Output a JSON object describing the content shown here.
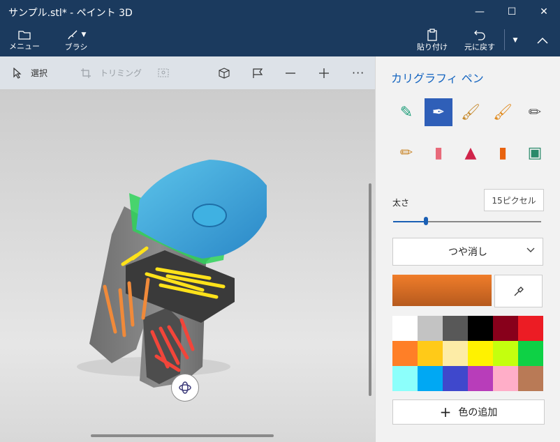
{
  "window": {
    "title": "サンプル.stl* - ペイント 3D",
    "minimize_glyph": "—",
    "maximize_glyph": "☐",
    "close_glyph": "✕"
  },
  "ribbon": {
    "menu_label": "メニュー",
    "brush_label": "ブラシ",
    "paste_label": "貼り付け",
    "undo_label": "元に戻す"
  },
  "toolbar": {
    "select_label": "選択",
    "trim_label": "トリミング"
  },
  "panel": {
    "title": "カリグラフィ ペン",
    "brushes": [
      {
        "name": "marker",
        "icon": "marker-icon",
        "color": "#1e9e7a"
      },
      {
        "name": "calligraphy-pen",
        "icon": "calligraphy-pen-icon",
        "selected": true
      },
      {
        "name": "oil-brush",
        "icon": "oil-brush-icon",
        "color": "#c68a2e"
      },
      {
        "name": "watercolor",
        "icon": "watercolor-icon",
        "color": "#e08a1e"
      },
      {
        "name": "pixel-pen",
        "icon": "pixel-pen-icon",
        "color": "#555555"
      },
      {
        "name": "pencil",
        "icon": "pencil-icon",
        "color": "#c9862a"
      },
      {
        "name": "eraser",
        "icon": "eraser-icon",
        "color": "#e86a7a"
      },
      {
        "name": "crayon",
        "icon": "crayon-icon",
        "color": "#d0244a"
      },
      {
        "name": "spray-can",
        "icon": "spray-can-icon",
        "color": "#e8620e"
      },
      {
        "name": "fill",
        "icon": "fill-bucket-icon",
        "color": "#2a8a6a"
      }
    ],
    "thickness_label": "太さ",
    "thickness_value": "15ピクセル",
    "thickness_level": 0.22,
    "finish_label": "つや消し",
    "current_color": "#f07d2a",
    "palette": [
      "#ffffff",
      "#c3c3c3",
      "#585858",
      "#000000",
      "#88001b",
      "#ec1c24",
      "#ff7f27",
      "#ffca18",
      "#fdeca6",
      "#fff200",
      "#c4ff0e",
      "#0ed145",
      "#8cfffb",
      "#00a8f3",
      "#3f48cc",
      "#b83dba",
      "#ffaec8",
      "#b97a56"
    ],
    "add_color_label": "色の追加"
  }
}
